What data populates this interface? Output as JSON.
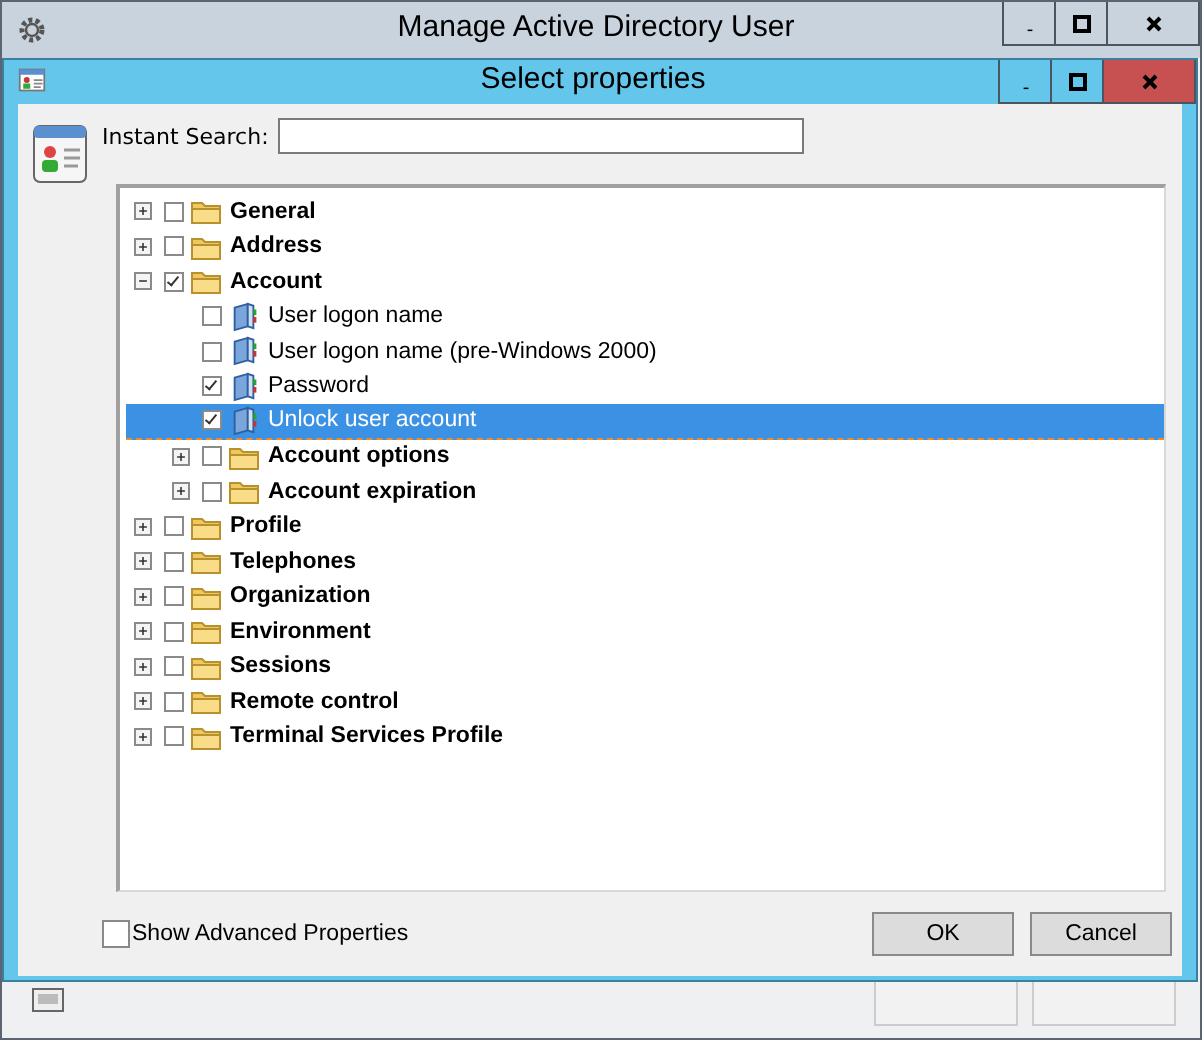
{
  "outer_window": {
    "title": "Manage Active Directory User"
  },
  "dialog": {
    "title": "Select properties",
    "search": {
      "label": "Instant Search:"
    },
    "tree": [
      {
        "kind": "folder",
        "label": "General",
        "expanded": false,
        "checked": false,
        "selected": false
      },
      {
        "kind": "folder",
        "label": "Address",
        "expanded": false,
        "checked": false,
        "selected": false
      },
      {
        "kind": "folder",
        "label": "Account",
        "expanded": true,
        "checked": true,
        "selected": false,
        "children": [
          {
            "kind": "property",
            "label": "User logon name",
            "checked": false,
            "selected": false
          },
          {
            "kind": "property",
            "label": "User logon name (pre-Windows 2000)",
            "checked": false,
            "selected": false
          },
          {
            "kind": "property",
            "label": "Password",
            "checked": true,
            "selected": false
          },
          {
            "kind": "property",
            "label": "Unlock user account",
            "checked": true,
            "selected": true
          },
          {
            "kind": "folder",
            "label": "Account options",
            "expanded": false,
            "checked": false,
            "selected": false
          },
          {
            "kind": "folder",
            "label": "Account expiration",
            "expanded": false,
            "checked": false,
            "selected": false
          }
        ]
      },
      {
        "kind": "folder",
        "label": "Profile",
        "expanded": false,
        "checked": false,
        "selected": false
      },
      {
        "kind": "folder",
        "label": "Telephones",
        "expanded": false,
        "checked": false,
        "selected": false
      },
      {
        "kind": "folder",
        "label": "Organization",
        "expanded": false,
        "checked": false,
        "selected": false
      },
      {
        "kind": "folder",
        "label": "Environment",
        "expanded": false,
        "checked": false,
        "selected": false
      },
      {
        "kind": "folder",
        "label": "Sessions",
        "expanded": false,
        "checked": false,
        "selected": false
      },
      {
        "kind": "folder",
        "label": "Remote control",
        "expanded": false,
        "checked": false,
        "selected": false
      },
      {
        "kind": "folder",
        "label": "Terminal Services Profile",
        "expanded": false,
        "checked": false,
        "selected": false
      }
    ],
    "advanced": {
      "label": "Show Advanced Properties",
      "checked": false
    },
    "buttons": [
      "OK",
      "Cancel"
    ]
  }
}
